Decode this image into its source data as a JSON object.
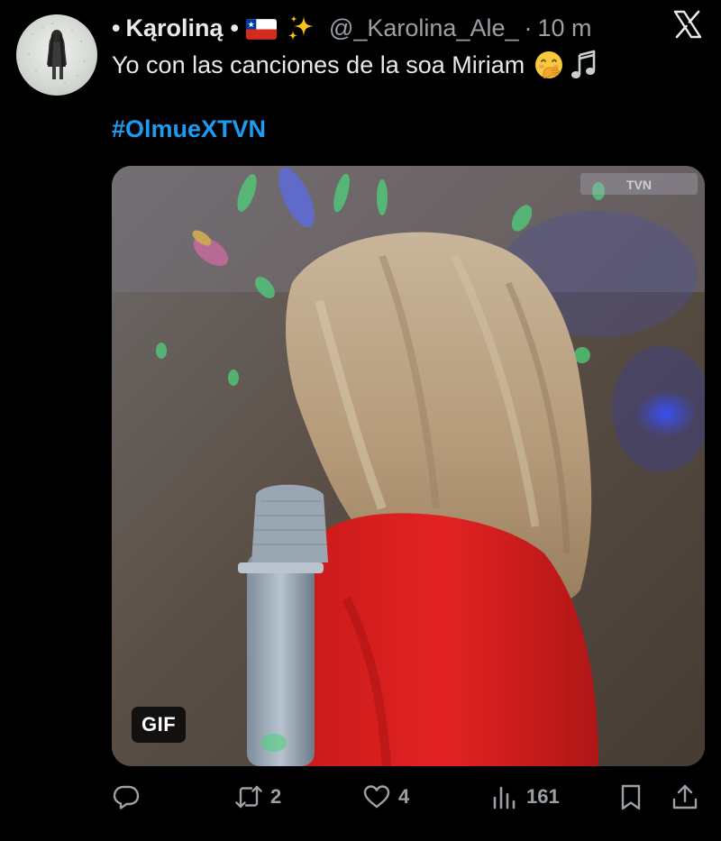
{
  "tweet": {
    "author_name": "Kąroliną",
    "bullet_left": "•",
    "bullet_right": "•",
    "handle": "@_Karolina_Ale_",
    "time_separator": "·",
    "time": "10 m",
    "text": "Yo con las canciones de la soa Miriam",
    "hashtag": "#OlmueXTVN"
  },
  "media": {
    "badge": "GIF",
    "watermark": "TVN"
  },
  "actions": {
    "reply_count": "",
    "retweet_count": "2",
    "like_count": "4",
    "views_count": "161"
  },
  "icons": {
    "flag": "chile-flag-icon",
    "sparkles": "sparkles-icon",
    "face": "face-with-hand-over-mouth-icon",
    "note": "musical-note-icon",
    "logo": "x-logo-icon",
    "reply": "reply-icon",
    "retweet": "retweet-icon",
    "like": "heart-icon",
    "views": "views-icon",
    "bookmark": "bookmark-icon",
    "share": "share-icon"
  },
  "colors": {
    "background": "#000000",
    "text": "#e7e9ea",
    "secondary": "#9aa0a6",
    "hashtag": "#1d9bf0"
  }
}
